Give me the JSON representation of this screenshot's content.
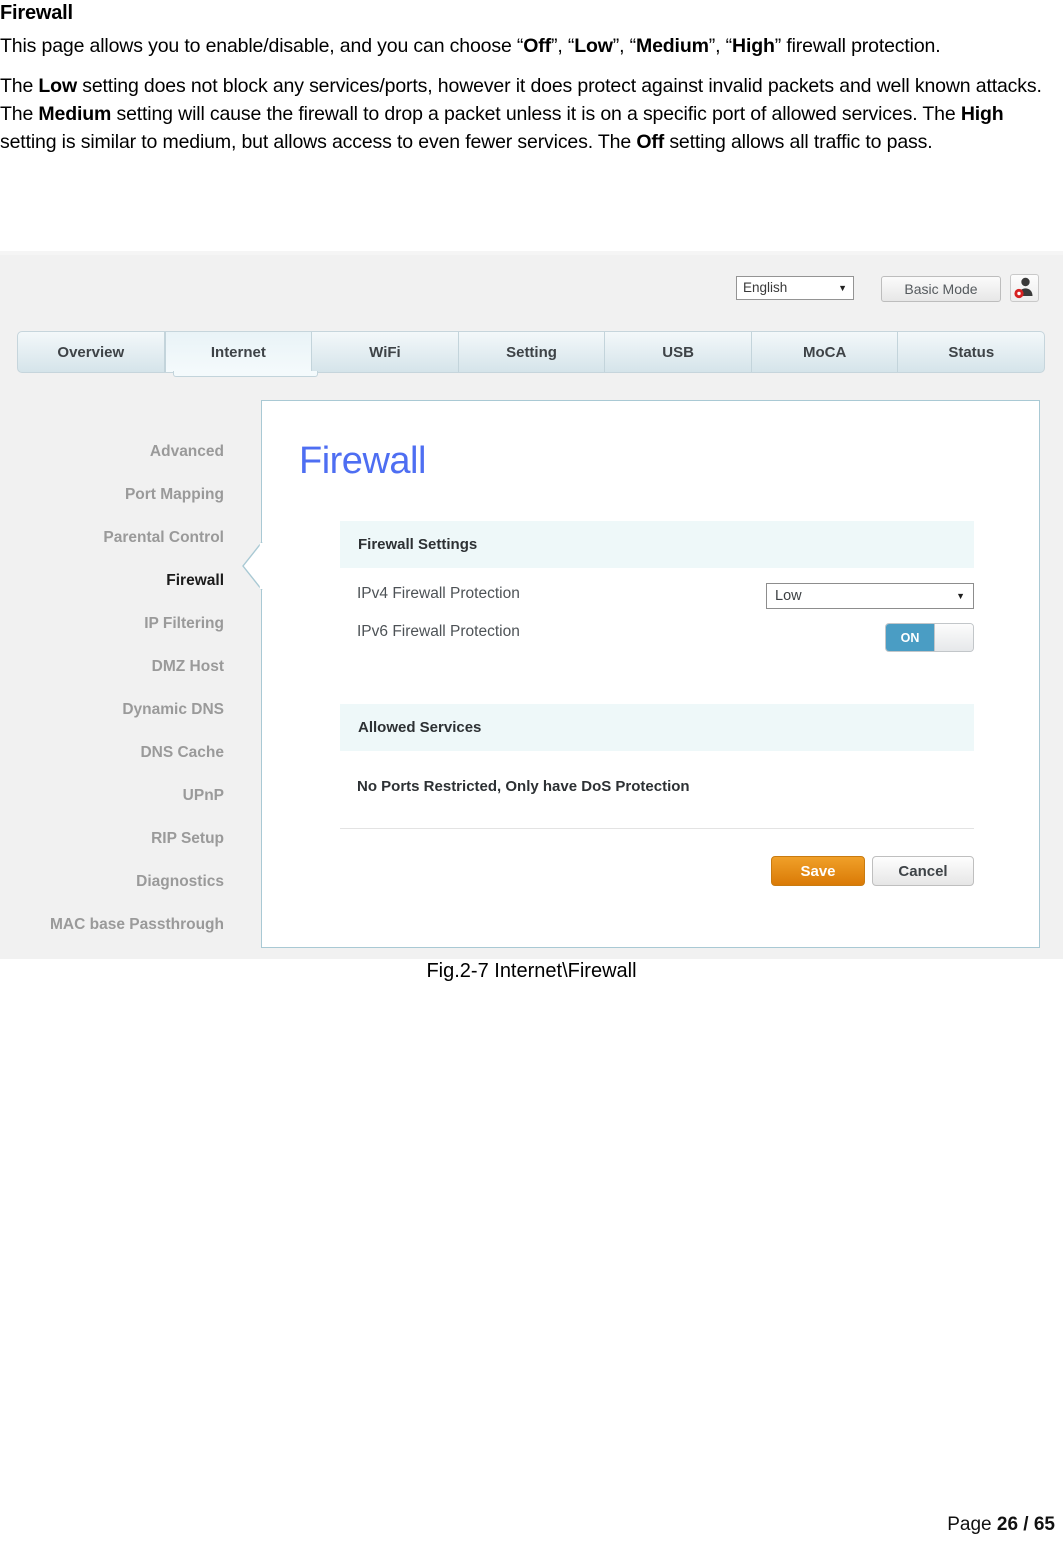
{
  "document": {
    "heading": "Firewall",
    "paragraph1_parts": [
      {
        "t": "This page allows you to enable/disable, and you can choose “",
        "b": false
      },
      {
        "t": "Off",
        "b": true
      },
      {
        "t": "”, “",
        "b": false
      },
      {
        "t": "Low",
        "b": true
      },
      {
        "t": "”, “",
        "b": false
      },
      {
        "t": "Medium",
        "b": true
      },
      {
        "t": "”, “",
        "b": false
      },
      {
        "t": "High",
        "b": true
      },
      {
        "t": "” firewall protection.",
        "b": false
      }
    ],
    "paragraph2_parts": [
      {
        "t": "The ",
        "b": false
      },
      {
        "t": "Low",
        "b": true
      },
      {
        "t": " setting does not block any services/ports, however it does protect against invalid packets and well known attacks. The ",
        "b": false
      },
      {
        "t": "Medium",
        "b": true
      },
      {
        "t": " setting will cause the firewall to drop a packet unless it is on a specific port of allowed services. The ",
        "b": false
      },
      {
        "t": "High",
        "b": true
      },
      {
        "t": " setting is similar to medium, but allows access to even fewer services. The ",
        "b": false
      },
      {
        "t": "Off",
        "b": true
      },
      {
        "t": " setting allows all traffic to pass.",
        "b": false
      }
    ],
    "figure_caption": "Fig.2-7 Internet\\Firewall",
    "footer_prefix": "Page ",
    "footer_pages": "26 / 65"
  },
  "screenshot": {
    "header": {
      "language_value": "English",
      "language_caret": "▼",
      "basic_mode_label": "Basic Mode",
      "user_icon_name": "user-settings-icon"
    },
    "nav_tabs": [
      {
        "label": "Overview",
        "active": false
      },
      {
        "label": "Internet",
        "active": true
      },
      {
        "label": "WiFi",
        "active": false
      },
      {
        "label": "Setting",
        "active": false
      },
      {
        "label": "USB",
        "active": false
      },
      {
        "label": "MoCA",
        "active": false
      },
      {
        "label": "Status",
        "active": false
      }
    ],
    "sidebar": [
      {
        "label": "Advanced",
        "active": false
      },
      {
        "label": "Port Mapping",
        "active": false
      },
      {
        "label": "Parental Control",
        "active": false
      },
      {
        "label": "Firewall",
        "active": true
      },
      {
        "label": "IP Filtering",
        "active": false
      },
      {
        "label": "DMZ Host",
        "active": false
      },
      {
        "label": "Dynamic DNS",
        "active": false
      },
      {
        "label": "DNS Cache",
        "active": false
      },
      {
        "label": "UPnP",
        "active": false
      },
      {
        "label": "RIP Setup",
        "active": false
      },
      {
        "label": "Diagnostics",
        "active": false
      },
      {
        "label": "MAC base Passthrough",
        "active": false
      }
    ],
    "panel": {
      "title": "Firewall",
      "title_color": "#4e6ef2",
      "section_firewall_settings": "Firewall Settings",
      "ipv4_label": "IPv4 Firewall Protection",
      "ipv4_value": "Low",
      "ipv4_caret": "▼",
      "ipv6_label": "IPv6 Firewall Protection",
      "ipv6_toggle_state": "ON",
      "section_allowed_services": "Allowed Services",
      "allowed_services_text": "No Ports Restricted, Only have DoS Protection",
      "save_label": "Save",
      "cancel_label": "Cancel",
      "accent_orange": "#e08a12",
      "accent_blue": "#4a9dc4"
    }
  }
}
